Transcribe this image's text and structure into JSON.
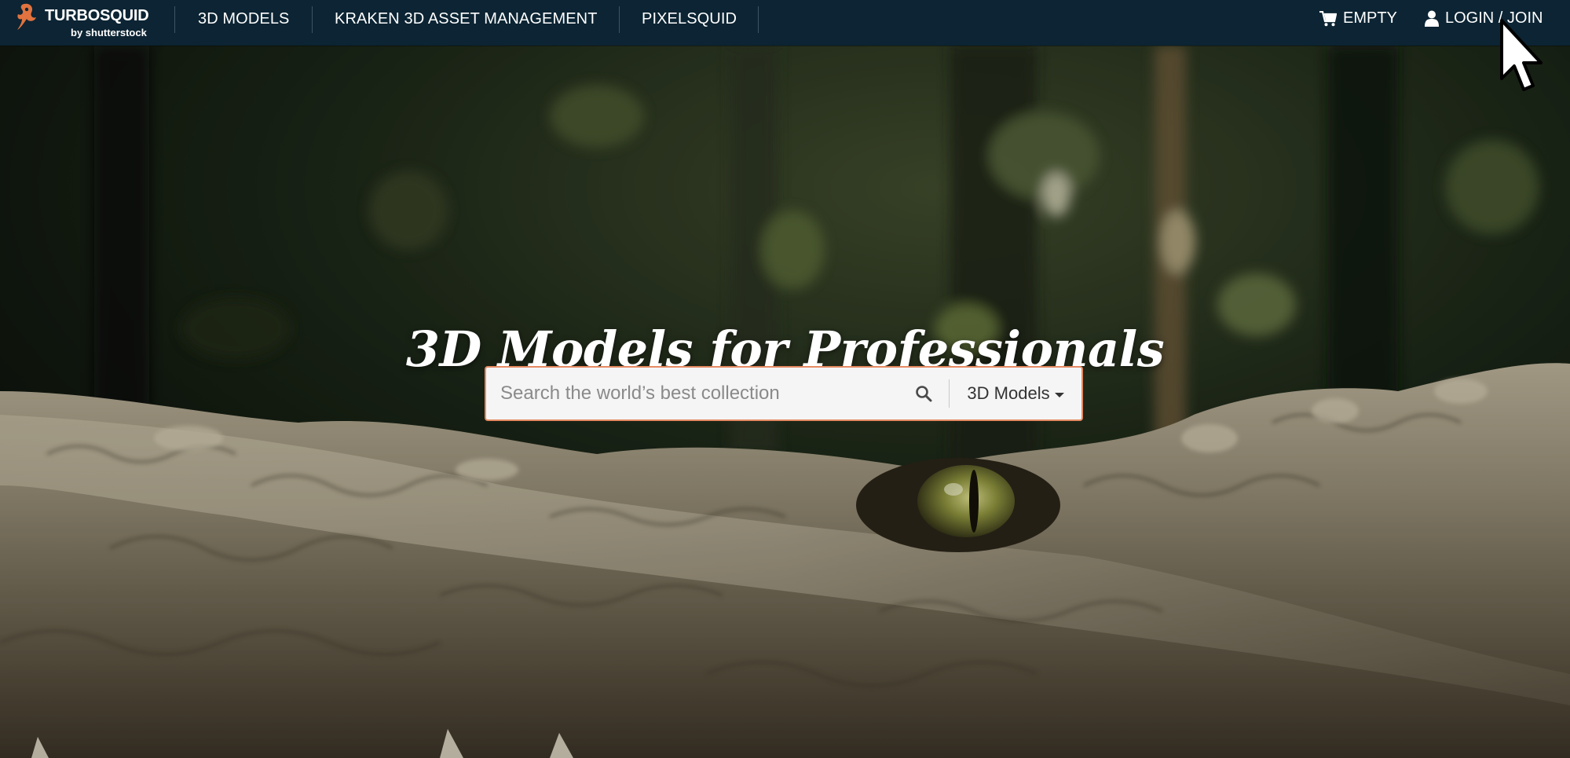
{
  "brand": {
    "name": "TURBOSQUID",
    "byline": "by shutterstock",
    "accent_color": "#e0733f"
  },
  "nav": {
    "links": [
      {
        "label": "3D MODELS"
      },
      {
        "label": "KRAKEN 3D ASSET MANAGEMENT"
      },
      {
        "label": "PIXELSQUID"
      }
    ],
    "cart": {
      "label": "EMPTY",
      "icon": "shopping-cart-icon"
    },
    "account": {
      "label": "LOGIN / JOIN",
      "icon": "user-icon"
    },
    "bar_color": "#0c2433"
  },
  "hero": {
    "title": "3D Models for Professionals",
    "background": "close-up of crocodile head in a dark forest",
    "search": {
      "placeholder": "Search the world’s best collection",
      "value": "",
      "scope_selected": "3D Models",
      "border_color": "#e58a62"
    }
  }
}
